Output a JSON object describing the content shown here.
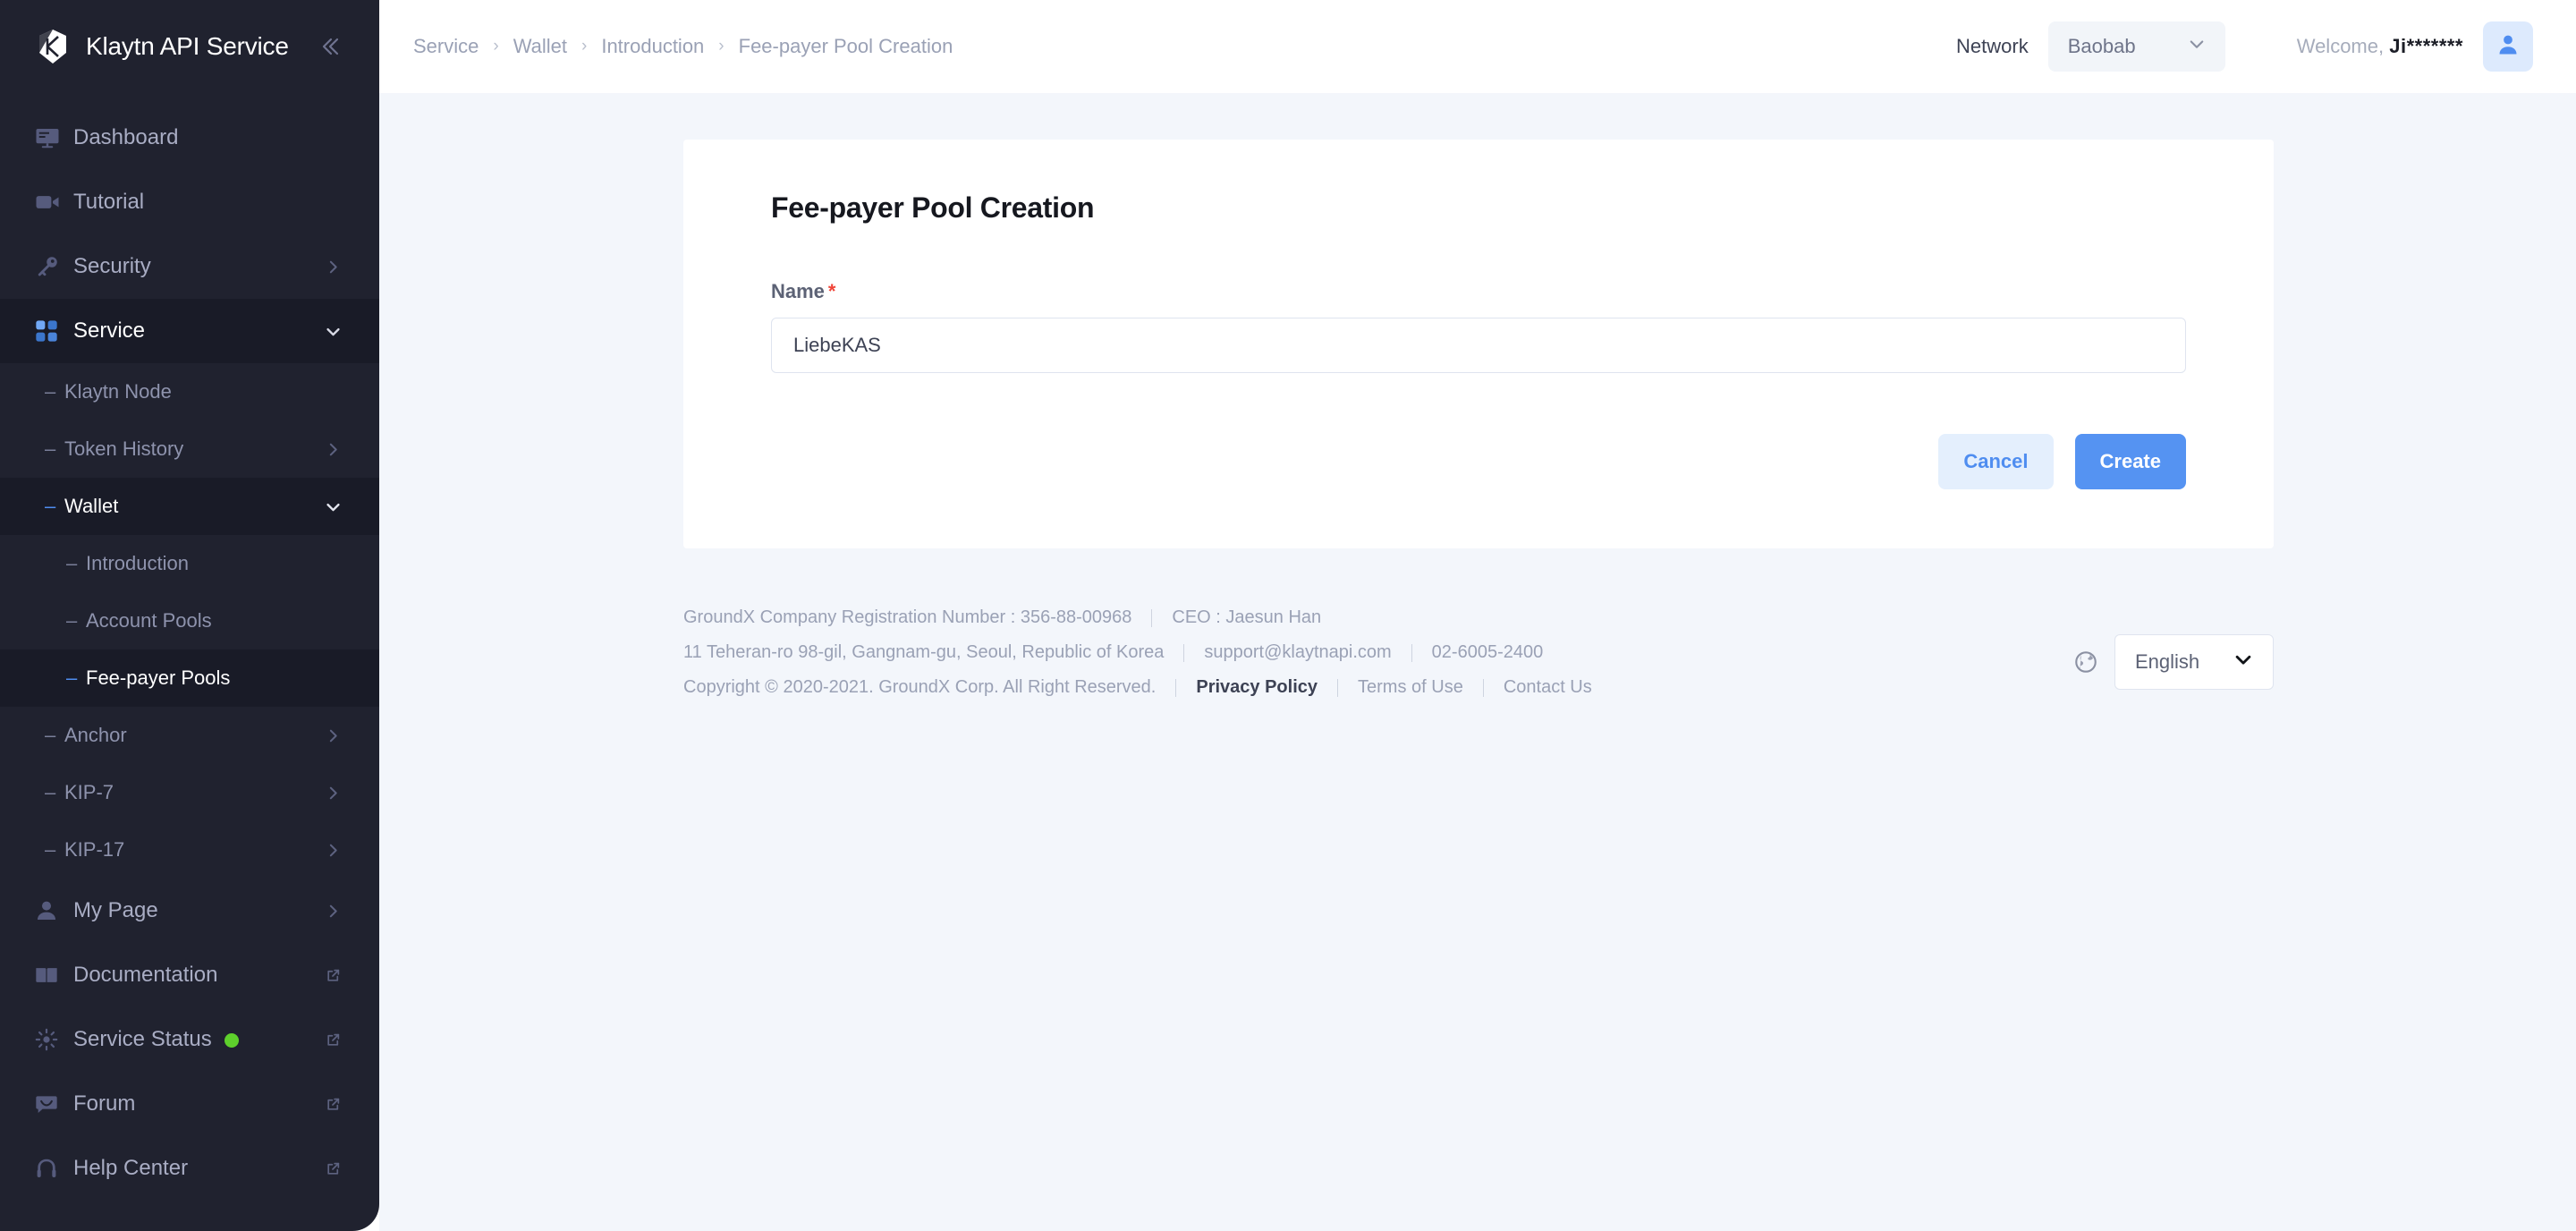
{
  "brand": {
    "name": "Klaytn API Service",
    "logo_icon": "klaytn-logo-icon",
    "collapse_icon": "collapse-left-icon"
  },
  "sidebar": {
    "items": [
      {
        "label": "Dashboard",
        "icon": "monitor-icon",
        "trail": "",
        "state": "normal",
        "level": 0
      },
      {
        "label": "Tutorial",
        "icon": "video-camera-icon",
        "trail": "",
        "state": "normal",
        "level": 0
      },
      {
        "label": "Security",
        "icon": "key-icon",
        "trail": "chevron-right-icon",
        "state": "normal",
        "level": 0
      },
      {
        "label": "Service",
        "icon": "grid-icon",
        "trail": "chevron-down-icon",
        "state": "active",
        "level": 0
      },
      {
        "label": "Klaytn Node",
        "icon": "dash",
        "trail": "",
        "state": "normal",
        "level": 1
      },
      {
        "label": "Token History",
        "icon": "dash",
        "trail": "chevron-right-icon",
        "state": "normal",
        "level": 1
      },
      {
        "label": "Wallet",
        "icon": "dash",
        "trail": "chevron-down-icon",
        "state": "active",
        "level": 1
      },
      {
        "label": "Introduction",
        "icon": "dash",
        "trail": "",
        "state": "normal",
        "level": 2
      },
      {
        "label": "Account Pools",
        "icon": "dash",
        "trail": "",
        "state": "normal",
        "level": 2
      },
      {
        "label": "Fee-payer Pools",
        "icon": "dash",
        "trail": "",
        "state": "selected",
        "level": 2
      },
      {
        "label": "Anchor",
        "icon": "dash",
        "trail": "chevron-right-icon",
        "state": "normal",
        "level": 1
      },
      {
        "label": "KIP-7",
        "icon": "dash",
        "trail": "chevron-right-icon",
        "state": "normal",
        "level": 1
      },
      {
        "label": "KIP-17",
        "icon": "dash",
        "trail": "chevron-right-icon",
        "state": "normal",
        "level": 1
      },
      {
        "label": "My Page",
        "icon": "person-icon",
        "trail": "chevron-right-icon",
        "state": "normal",
        "level": 0
      },
      {
        "label": "Documentation",
        "icon": "book-icon",
        "trail": "external-link-icon",
        "state": "normal",
        "level": 0
      },
      {
        "label": "Service Status",
        "icon": "sun-icon",
        "trail": "external-link-icon",
        "state": "normal",
        "level": 0,
        "badge": "online-dot"
      },
      {
        "label": "Forum",
        "icon": "chat-icon",
        "trail": "external-link-icon",
        "state": "normal",
        "level": 0
      },
      {
        "label": "Help Center",
        "icon": "headset-icon",
        "trail": "external-link-icon",
        "state": "normal",
        "level": 0
      }
    ]
  },
  "topbar": {
    "breadcrumb": [
      "Service",
      "Wallet",
      "Introduction",
      "Fee-payer Pool Creation"
    ],
    "breadcrumb_separator": "›",
    "network_label": "Network",
    "network_value": "Baobab",
    "network_chevron": "chevron-down-icon",
    "welcome_prefix": "Welcome, ",
    "welcome_user": "Ji*******",
    "avatar_icon": "user-avatar-icon"
  },
  "card": {
    "title": "Fee-payer Pool Creation",
    "name_label": "Name",
    "required_mark": "*",
    "name_value": "LiebeKAS",
    "name_placeholder": "",
    "cancel_label": "Cancel",
    "create_label": "Create"
  },
  "footer": {
    "line1_registration": "GroundX Company Registration Number : 356-88-00968",
    "line1_ceo": "CEO : Jaesun Han",
    "line2_address": "11 Teheran-ro 98-gil, Gangnam-gu, Seoul, Republic of Korea",
    "line2_email": "support@klaytnapi.com",
    "line2_phone": "02-6005-2400",
    "line3_copyright": "Copyright © 2020-2021. GroundX Corp. All Right Reserved.",
    "privacy": "Privacy Policy",
    "terms": "Terms of Use",
    "contact": "Contact Us",
    "globe_icon": "globe-icon",
    "language_value": "English",
    "language_chevron": "chevron-down-icon"
  },
  "colors": {
    "sidebar_bg": "#20222f",
    "sidebar_active_bg": "#191b27",
    "accent_blue": "#4f8df0",
    "primary_button": "#5593f2",
    "cancel_button": "#e4effd",
    "page_bg": "#f3f6fb",
    "required_red": "#f04438",
    "status_green": "#5ed02c"
  }
}
